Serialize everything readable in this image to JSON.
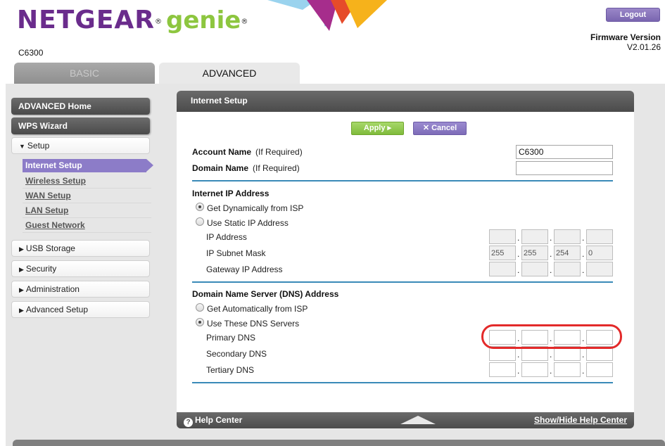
{
  "header": {
    "brand": "NETGEAR",
    "brand_mark": "®",
    "product": "genie",
    "product_mark": "®",
    "model": "C6300",
    "logout_label": "Logout",
    "firmware_label": "Firmware Version",
    "firmware_value": "V2.01.26"
  },
  "tabs": [
    {
      "label": "BASIC",
      "active": false
    },
    {
      "label": "ADVANCED",
      "active": true
    }
  ],
  "sidebar": {
    "advanced_home": "ADVANCED Home",
    "wps_wizard": "WPS Wizard",
    "setup": {
      "label": "Setup",
      "expanded": true,
      "items": [
        {
          "label": "Internet Setup",
          "active": true
        },
        {
          "label": "Wireless Setup",
          "active": false
        },
        {
          "label": "WAN Setup",
          "active": false
        },
        {
          "label": "LAN Setup",
          "active": false
        },
        {
          "label": "Guest Network",
          "active": false
        }
      ]
    },
    "usb_storage": "USB Storage",
    "security": "Security",
    "administration": "Administration",
    "advanced_setup": "Advanced Setup"
  },
  "panel": {
    "title": "Internet Setup",
    "apply_label": "Apply ▸",
    "cancel_label": "Cancel",
    "account_name_label": "Account Name",
    "account_name_hint": "(If Required)",
    "account_name_value": "C6300",
    "domain_name_label": "Domain Name",
    "domain_name_hint": "(If Required)",
    "domain_name_value": "",
    "ip_section": {
      "title": "Internet IP Address",
      "option_dynamic": "Get Dynamically from ISP",
      "option_static": "Use Static IP Address",
      "selected": "dynamic",
      "ip_label": "IP Address",
      "ip_octets": [
        "",
        "",
        "",
        ""
      ],
      "mask_label": "IP Subnet Mask",
      "mask_octets": [
        "255",
        "255",
        "254",
        "0"
      ],
      "gateway_label": "Gateway IP Address",
      "gateway_octets": [
        "",
        "",
        "",
        ""
      ]
    },
    "dns_section": {
      "title": "Domain Name Server (DNS) Address",
      "option_auto": "Get Automatically from ISP",
      "option_manual": "Use These DNS Servers",
      "selected": "manual",
      "primary_label": "Primary DNS",
      "primary_octets": [
        "",
        "",
        "",
        ""
      ],
      "secondary_label": "Secondary DNS",
      "secondary_octets": [
        "",
        "",
        "",
        ""
      ],
      "tertiary_label": "Tertiary DNS",
      "tertiary_octets": [
        "",
        "",
        "",
        ""
      ]
    },
    "footer": {
      "help_center": "Help Center",
      "show_hide": "Show/Hide Help Center"
    }
  },
  "colors": {
    "brand_purple": "#6a2c8c",
    "genie_green": "#8dc63f",
    "active_nav": "#8c7cc8",
    "rule_blue": "#3a8ab8",
    "highlight_red": "#e32a2a"
  }
}
